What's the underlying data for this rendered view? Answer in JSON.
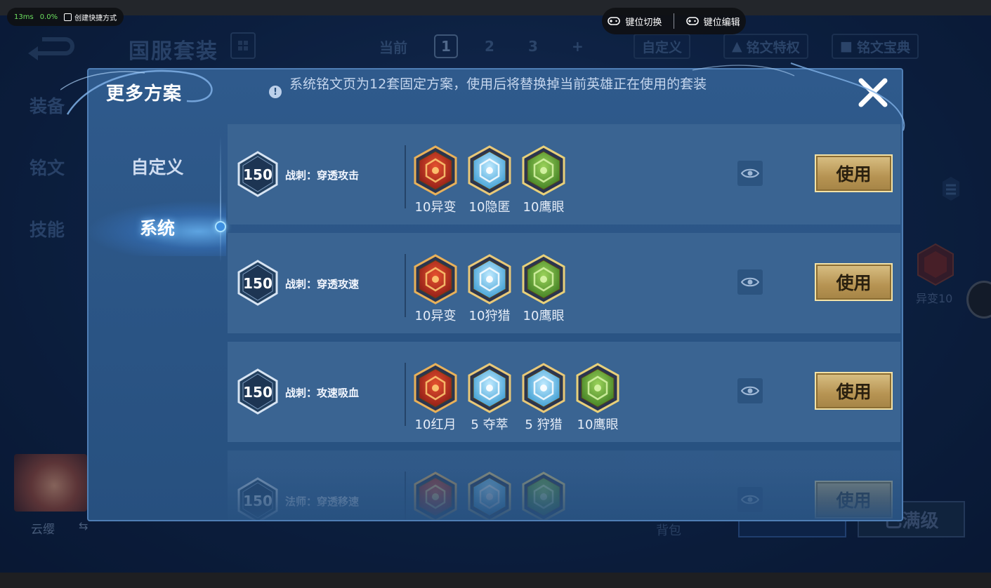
{
  "emulator": {
    "latency": "13ms",
    "cpu": "0.0%",
    "shortcut_label": "创建快捷方式",
    "key_switch_label": "键位切换",
    "key_edit_label": "键位编辑"
  },
  "background": {
    "title": "国服套装",
    "pages": [
      "当前",
      "1",
      "2",
      "3",
      "+"
    ],
    "active_page": "1",
    "right_buttons": [
      "自定义",
      "铭文特权",
      "铭文宝典"
    ],
    "side_tabs": [
      "装备",
      "铭文",
      "技能"
    ],
    "hero_name": "云缨",
    "bag_label": "背包",
    "max_level_label": "已满级",
    "rune_label": "异变10"
  },
  "modal": {
    "title": "更多方案",
    "notice": "系统铭文页为12套固定方案，使用后将替换掉当前英雄正在使用的套装",
    "categories": [
      {
        "label": "自定义",
        "active": false
      },
      {
        "label": "系统",
        "active": true
      }
    ],
    "plans": [
      {
        "level": "150",
        "name": "战刺：穿透攻击",
        "use_label": "使用",
        "runes": [
          {
            "label": "10异变",
            "icon": "red-rune-icon",
            "color": "#c9392a"
          },
          {
            "label": "10隐匿",
            "icon": "blue-rune-icon",
            "color": "#5ab7e6"
          },
          {
            "label": "10鹰眼",
            "icon": "green-rune-icon",
            "color": "#6fae3a"
          }
        ]
      },
      {
        "level": "150",
        "name": "战刺：穿透攻速",
        "use_label": "使用",
        "runes": [
          {
            "label": "10异变",
            "icon": "red-rune-icon",
            "color": "#c9392a"
          },
          {
            "label": "10狩猎",
            "icon": "blue-rune-icon",
            "color": "#5ab7e6"
          },
          {
            "label": "10鹰眼",
            "icon": "green-rune-icon",
            "color": "#6fae3a"
          }
        ]
      },
      {
        "level": "150",
        "name": "战刺：攻速吸血",
        "use_label": "使用",
        "runes": [
          {
            "label": "10红月",
            "icon": "red-rune-icon",
            "color": "#c9392a"
          },
          {
            "label": "5 夺萃",
            "icon": "blue-rune-icon",
            "color": "#5ab7e6"
          },
          {
            "label": "5 狩猎",
            "icon": "blue-rune-icon",
            "color": "#5ab7e6"
          },
          {
            "label": "10鹰眼",
            "icon": "green-rune-icon",
            "color": "#6fae3a"
          }
        ]
      },
      {
        "level": "150",
        "name": "法师：穿透移速",
        "use_label": "使用",
        "runes": [
          {
            "label": "",
            "icon": "red-rune-icon",
            "color": "#c9392a"
          },
          {
            "label": "",
            "icon": "blue-rune-icon",
            "color": "#5ab7e6"
          },
          {
            "label": "",
            "icon": "green-rune-icon",
            "color": "#6fae3a"
          }
        ]
      }
    ]
  },
  "colors": {
    "modal_bg": "#2f5a8c",
    "row_bg": "#3a6492",
    "gold": "#d9c084"
  }
}
